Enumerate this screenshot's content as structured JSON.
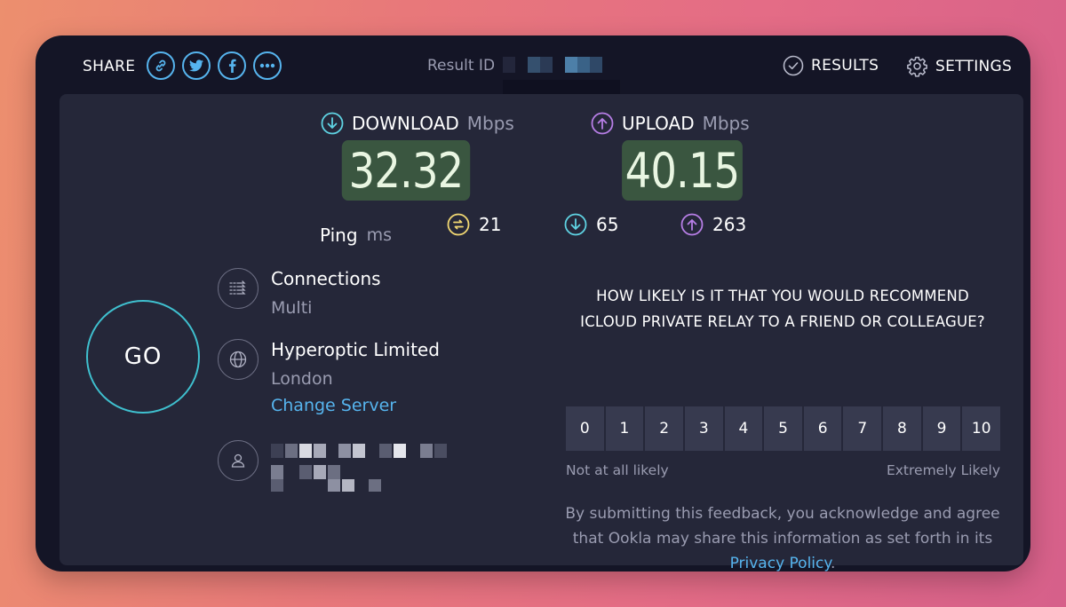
{
  "topbar": {
    "share_label": "SHARE",
    "share_icons": [
      "link-icon",
      "twitter-icon",
      "facebook-icon",
      "more-icon"
    ],
    "result_id_label": "Result ID",
    "results_label": "RESULTS",
    "settings_label": "SETTINGS"
  },
  "download": {
    "label": "DOWNLOAD",
    "unit": "Mbps",
    "value": "32.32"
  },
  "upload": {
    "label": "UPLOAD",
    "unit": "Mbps",
    "value": "40.15"
  },
  "ping": {
    "label": "Ping",
    "unit": "ms",
    "idle": "21",
    "download": "65",
    "upload": "263"
  },
  "go_label": "GO",
  "connections": {
    "title": "Connections",
    "value": "Multi"
  },
  "server": {
    "isp": "Hyperoptic Limited",
    "location": "London",
    "change_label": "Change Server"
  },
  "survey": {
    "question": "HOW LIKELY IS IT THAT YOU WOULD RECOMMEND ICLOUD PRIVATE RELAY TO A FRIEND OR COLLEAGUE?",
    "scale": [
      "0",
      "1",
      "2",
      "3",
      "4",
      "5",
      "6",
      "7",
      "8",
      "9",
      "10"
    ],
    "low_label": "Not at all likely",
    "high_label": "Extremely Likely",
    "disclaimer_pre": "By submitting this feedback, you acknowledge and agree that Ookla may share this information as set forth in its ",
    "privacy_link": "Privacy Policy",
    "disclaimer_post": "."
  },
  "colors": {
    "accent_blue": "#56b4ee",
    "go_ring": "#3fc0cf",
    "value_bg": "#3a5640",
    "ping_idle": "#f1d772",
    "ping_down": "#5fd3e3",
    "ping_up": "#b77ee6"
  }
}
